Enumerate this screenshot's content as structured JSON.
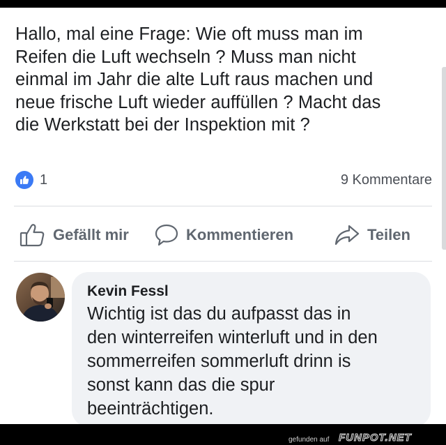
{
  "post": {
    "lines": [
      "Hallo, mal eine Frage: Wie oft muss man im",
      "Reifen die Luft wechseln ? Muss man nicht",
      "einmal im Jahr die alte Luft raus machen und",
      "neue frische Luft wieder auffüllen ? Macht das",
      "die Werkstatt bei der Inspektion mit ?"
    ],
    "like_count": "1",
    "comment_count": "9 Kommentare",
    "actions": {
      "like": "Gefällt mir",
      "comment": "Kommentieren",
      "share": "Teilen"
    }
  },
  "comment": {
    "author": "Kevin Fessl",
    "lines": [
      "Wichtig ist das du aufpasst das in",
      "den winterreifen winterluft und in den",
      "sommerreifen sommerluft drinn is",
      "sonst kann das die spur",
      "beeinträchtigen."
    ]
  },
  "watermark": {
    "prefix": "gefunden auf",
    "site": "FUNPOT.NET"
  },
  "icons": {
    "reaction": "like-thumb-icon",
    "like_action": "thumbs-up-outline-icon",
    "comment_action": "speech-bubble-icon",
    "share_action": "share-arrow-icon"
  },
  "colors": {
    "like_blue": "#3b7af5",
    "text": "#1c1e21",
    "muted": "#606770",
    "bubble": "#f0f2f5"
  }
}
